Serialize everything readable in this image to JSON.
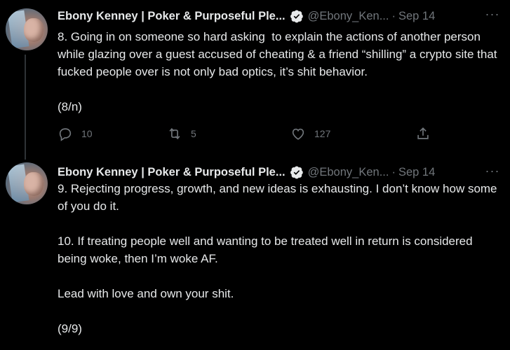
{
  "tweets": [
    {
      "author_name": "Ebony Kenney | Poker & Purposeful Ple...",
      "handle": "@Ebony_Ken...",
      "separator": "·",
      "date": "Sep 14",
      "more": "···",
      "text": "8. Going in on someone so hard asking  to explain the actions of another person while glazing over a guest accused of cheating & a friend “shilling” a crypto site that fucked people over is not only bad optics, it’s shit behavior.\n\n(8/n)",
      "replies": "10",
      "retweets": "5",
      "likes": "127"
    },
    {
      "author_name": "Ebony Kenney | Poker & Purposeful Ple...",
      "handle": "@Ebony_Ken...",
      "separator": "·",
      "date": "Sep 14",
      "more": "···",
      "text": "9. Rejecting progress, growth, and new ideas is exhausting. I don’t know how some of you do it.\n\n10. If treating people well and wanting to be treated well in return is considered being woke, then I’m woke AF.\n\nLead with love and own your shit.\n\n(9/9)"
    }
  ],
  "colors": {
    "background": "#000000",
    "text": "#e7e9ea",
    "muted": "#71767b",
    "thread_line": "#2f3336"
  },
  "icons": [
    "verified-badge-icon",
    "more-icon",
    "reply-icon",
    "retweet-icon",
    "like-icon",
    "share-icon"
  ]
}
